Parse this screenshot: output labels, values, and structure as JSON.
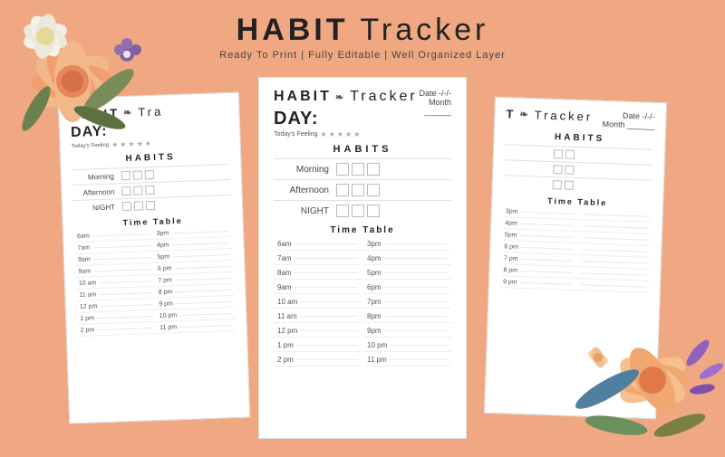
{
  "page": {
    "title_bold": "HABIT",
    "title_light": " Tracker",
    "subtitle": "Ready To Print | Fully Editable | Well Organized Layer",
    "bg_color": "#f0a882"
  },
  "cards": {
    "left": {
      "title_bold": "HABIT",
      "title_icon": "❧",
      "title_light": "Tra",
      "day_label": "DAY:",
      "feeling_label": "Today's Feeling",
      "date_text": "",
      "section_habits": "HABITS",
      "habits": [
        "Morning",
        "Afternoon",
        "NIGHT"
      ],
      "section_time": "Time Table",
      "times_left": [
        "6am",
        "7am",
        "8am",
        "9am",
        "10 am",
        "11 am",
        "12 pm",
        "1 pm",
        "2 pm"
      ],
      "times_right": [
        "3pm",
        "4pm",
        "5pm",
        "6 pm",
        "7 pm",
        "8 pm",
        "9 pm",
        "10 pm",
        "11 pm"
      ]
    },
    "center": {
      "title_bold": "HABIT",
      "title_icon": "❧",
      "title_light": "Tracker",
      "day_label": "DAY:",
      "feeling_label": "Today's Feeling",
      "date_label": "Date",
      "date_value": "-/-/-",
      "month_label": "Month",
      "month_value": "______",
      "section_habits": "HABITS",
      "habits": [
        "Morning",
        "Afternoon",
        "NIGHT"
      ],
      "section_time": "Time Table",
      "times_left": [
        "6am",
        "7am",
        "8am",
        "9am",
        "10 am",
        "11 am",
        "12 pm",
        "1 pm",
        "2 pm"
      ],
      "times_right": [
        "3pm",
        "4pm",
        "5pm",
        "6pm",
        "7pm",
        "8pm",
        "9pm",
        "10 pm",
        "11 pm"
      ]
    },
    "right": {
      "title_bold": "T",
      "title_icon": "❧",
      "title_light": "Tracker",
      "day_label": "",
      "date_label": "Date",
      "date_value": "-/-/-",
      "month_label": "Month",
      "month_value": "______",
      "section_habits": "HABITS",
      "section_time": "Time Table",
      "times_right": [
        "3pm",
        "4pm",
        "5pm",
        "6 pm",
        "7 pm",
        "8 pm",
        "9 pm"
      ]
    }
  }
}
